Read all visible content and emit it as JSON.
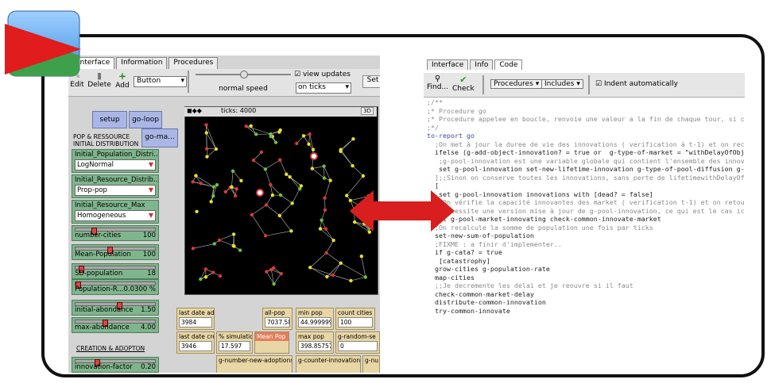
{
  "left": {
    "tabs": [
      "Interface",
      "Information",
      "Procedures"
    ],
    "toolbar": {
      "edit": "Edit",
      "delete": "Delete",
      "add": "Add",
      "widget_select": "Button",
      "speed_label": "normal speed",
      "view_updates": "view updates",
      "on_ticks": "on ticks",
      "settings": "Set"
    },
    "buttons": {
      "setup": "setup",
      "go_loop": "go-loop",
      "go_ma": "go-ma..."
    },
    "labels": {
      "pop_resource": "POP & RESSOURCE",
      "initial_distribution": "INITIAL DISTRIBUTION",
      "creation_adoption": "CREATION & ADOPTON"
    },
    "choosers": [
      {
        "name": "Initial_Population_Distri...",
        "value": "LogNormal"
      },
      {
        "name": "Initial_Resource_Distrib...",
        "value": "Prop-pop"
      },
      {
        "name": "Initial_Resource_Max",
        "value": "Homogeneous"
      }
    ],
    "sliders": [
      {
        "name": "number-cities",
        "value": "100"
      },
      {
        "name": "Mean-Population",
        "value": "100"
      },
      {
        "name": "SD-population",
        "value": "18"
      },
      {
        "name": "Population-R...",
        "value": "0.0300 %"
      },
      {
        "name": "initial-abondance",
        "value": "1.50"
      },
      {
        "name": "max-abondance",
        "value": "4.00"
      },
      {
        "name": "innovation-factor",
        "value": "0.20"
      }
    ],
    "world": {
      "ticks": "ticks: 4000",
      "three_d": "3D"
    },
    "monitors": [
      {
        "name": "last date ad",
        "value": "3984"
      },
      {
        "name": "all-pop",
        "value": "7037.58"
      },
      {
        "name": "min pop",
        "value": "44.999999"
      },
      {
        "name": "count cities",
        "value": "100"
      },
      {
        "name": "last date cre",
        "value": "3946"
      },
      {
        "name": "% simulatio",
        "value": "17.597"
      },
      {
        "name": "Mean Pop",
        "value": ""
      },
      {
        "name": "max pop",
        "value": "398.857576"
      },
      {
        "name": "g-random-se",
        "value": "0"
      },
      {
        "name": "g-number-new-adoptions",
        "value": ""
      },
      {
        "name": "g-counter-innovation",
        "value": ""
      },
      {
        "name": "g-nu",
        "value": ""
      }
    ]
  },
  "right": {
    "tabs": [
      "Interface",
      "Info",
      "Code"
    ],
    "toolbar": {
      "find": "Find...",
      "check": "Check",
      "procedures": "Procedures",
      "includes": "Includes",
      "indent": "Indent automatically"
    },
    "code_lines": [
      ";/**",
      ";* Procedure go",
      ";* Procedure appelee en boucle, renvoie une valeur a la fin de chaque tour, si cette",
      ";*/",
      "",
      "to-report go",
      "",
      "  ;On met à jour la duree de vie des innovations ( verification à t-1) et on recupere",
      "  ifelse (g-add-object-innovation? = true or  g-type-of-market = \"withDelayOfObjectIn",
      "   ;g-pool-innovation est une variable globale qui contient l'ensemble des innovati",
      "   set g-pool-innovation set-new-lifetime-innovation g-type-of-pool-diffusion g-max",
      "  ];;Sinon on conserve toutes les innovations, sans perte de lifetimewithDelayOfObje",
      "  [",
      "   set g-pool-innovation innovations with [dead? = false]",
      "",
      "",
      "  ; On vérifie la capacité innovantes des market ( verification t-1) et on retourne",
      "  ; Necessite une version mise à jour de g-pool-innovation, ce qui est le cas ici.",
      "  set g-pool-market-innovating check-common-innovate-market",
      "",
      "  ;On recalcule la somme de population une fois par ticks",
      "  set-new-sum-of-population",
      "",
      "  ;FIXME : a finir d'implementer..",
      "  if g-cata? = true",
      "   [catastrophy]",
      "",
      "  grow-cities g-population-rate",
      "  map-cities",
      "",
      "  ;;Je decremente les delai et je reouvre si il faut",
      "  check-common-market-delay",
      "  distribute-common-innovation",
      "  try-common-innovate"
    ]
  },
  "colors": {
    "button": "#aab7e6",
    "chooser": "#7fb58c",
    "monitor": "#e8d6a6",
    "arrow": "#d81e1e",
    "frame": "#111111"
  }
}
